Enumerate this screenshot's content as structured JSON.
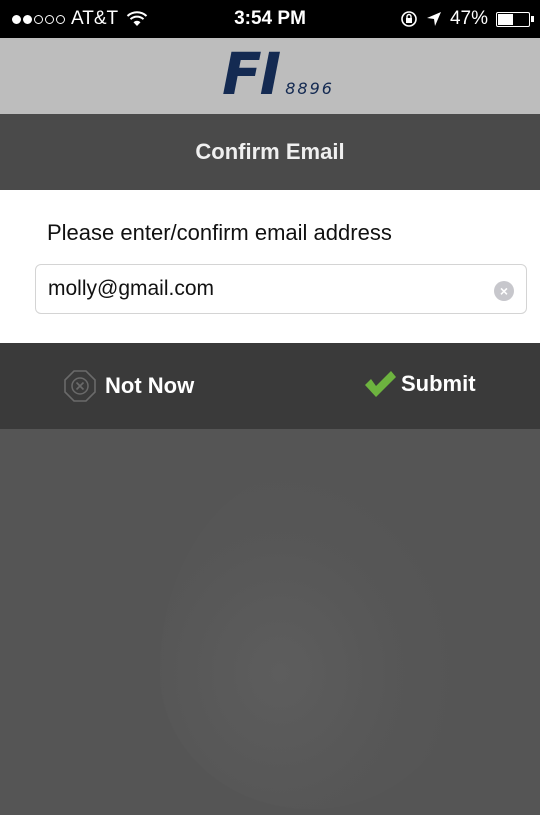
{
  "status_bar": {
    "carrier": "AT&T",
    "time": "3:54 PM",
    "battery_percent": "47%",
    "battery_level": 0.47,
    "signal_bars_filled": 2,
    "signal_bars_total": 5,
    "icons": [
      "wifi-icon",
      "rotation-lock-icon",
      "location-arrow-icon",
      "battery-icon"
    ]
  },
  "header": {
    "logo_text": "FI",
    "logo_number": "8896",
    "logo_color": "#142a52"
  },
  "title_bar": {
    "title": "Confirm Email"
  },
  "form": {
    "prompt": "Please enter/confirm email address",
    "email_value": "molly@gmail.com"
  },
  "actions": {
    "not_now_label": "Not Now",
    "submit_label": "Submit",
    "submit_icon_color": "#6db33f"
  }
}
